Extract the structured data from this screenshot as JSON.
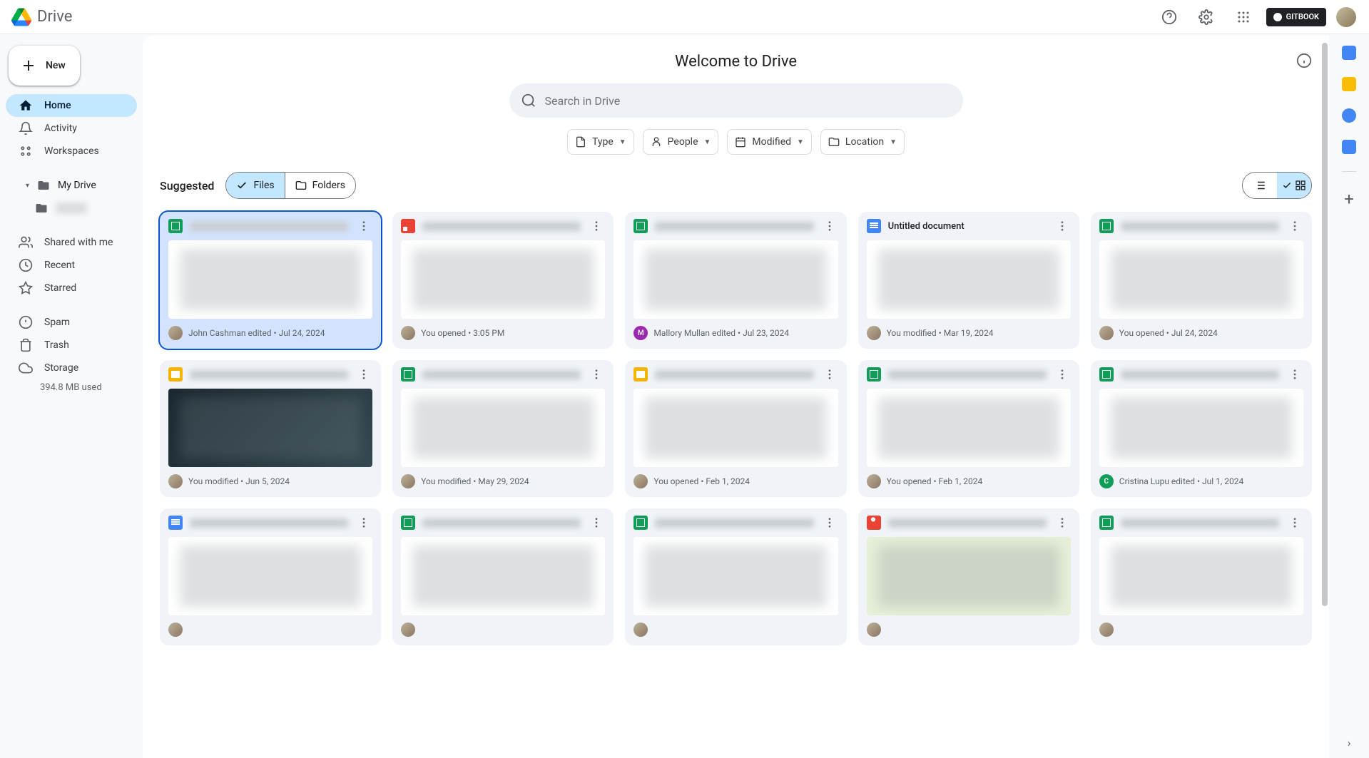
{
  "app_name": "Drive",
  "gitbook_label": "GITBOOK",
  "new_button": "New",
  "nav": {
    "home": "Home",
    "activity": "Activity",
    "workspaces": "Workspaces",
    "mydrive": "My Drive",
    "subfolder": "Hidden",
    "shared": "Shared with me",
    "recent": "Recent",
    "starred": "Starred",
    "spam": "Spam",
    "trash": "Trash",
    "storage": "Storage",
    "storage_used": "394.8 MB used"
  },
  "page_title": "Welcome to Drive",
  "search_placeholder": "Search in Drive",
  "filters": {
    "type": "Type",
    "people": "People",
    "modified": "Modified",
    "location": "Location"
  },
  "section": {
    "suggested": "Suggested",
    "files": "Files",
    "folders": "Folders"
  },
  "files": [
    {
      "type": "sheets",
      "title": "██████████████████████",
      "blurred": true,
      "meta": "John Cashman edited • Jul 24, 2024",
      "avatar": "photo",
      "selected": true
    },
    {
      "type": "image",
      "title": "██████████",
      "blurred": true,
      "meta": "You opened • 3:05 PM",
      "avatar": "photo"
    },
    {
      "type": "sheets",
      "title": "████████████████████",
      "blurred": true,
      "meta": "Mallory Mullan edited • Jul 23, 2024",
      "avatar": "mallory"
    },
    {
      "type": "docs",
      "title": "Untitled document",
      "blurred": false,
      "meta": "You modified • Mar 19, 2024",
      "avatar": "photo"
    },
    {
      "type": "sheets",
      "title": "██████████████████",
      "blurred": true,
      "meta": "You opened • Jul 24, 2024",
      "avatar": "photo"
    },
    {
      "type": "slides",
      "title": "████████",
      "blurred": true,
      "meta": "You modified • Jun 5, 2024",
      "avatar": "photo",
      "thumb": "dark"
    },
    {
      "type": "sheets",
      "title": "██████████",
      "blurred": true,
      "meta": "You modified • May 29, 2024",
      "avatar": "photo"
    },
    {
      "type": "slides",
      "title": "████████████████",
      "blurred": true,
      "meta": "You opened • Feb 1, 2024",
      "avatar": "photo"
    },
    {
      "type": "sheets",
      "title": "████████████████████",
      "blurred": true,
      "meta": "You opened • Feb 1, 2024",
      "avatar": "photo"
    },
    {
      "type": "sheets",
      "title": "██████████████████████",
      "blurred": true,
      "meta": "Cristina Lupu edited • Jul 1, 2024",
      "avatar": "cristina"
    },
    {
      "type": "docs",
      "title": "████████████████████",
      "blurred": true,
      "meta": "",
      "avatar": "photo"
    },
    {
      "type": "sheets",
      "title": "████",
      "blurred": true,
      "meta": "",
      "avatar": "photo"
    },
    {
      "type": "sheets",
      "title": "██████████████████████",
      "blurred": true,
      "meta": "",
      "avatar": "photo"
    },
    {
      "type": "maps",
      "title": "████████████████████",
      "blurred": true,
      "meta": "",
      "avatar": "photo",
      "thumb": "map"
    },
    {
      "type": "sheets",
      "title": "██████",
      "blurred": true,
      "meta": "",
      "avatar": "photo"
    }
  ]
}
